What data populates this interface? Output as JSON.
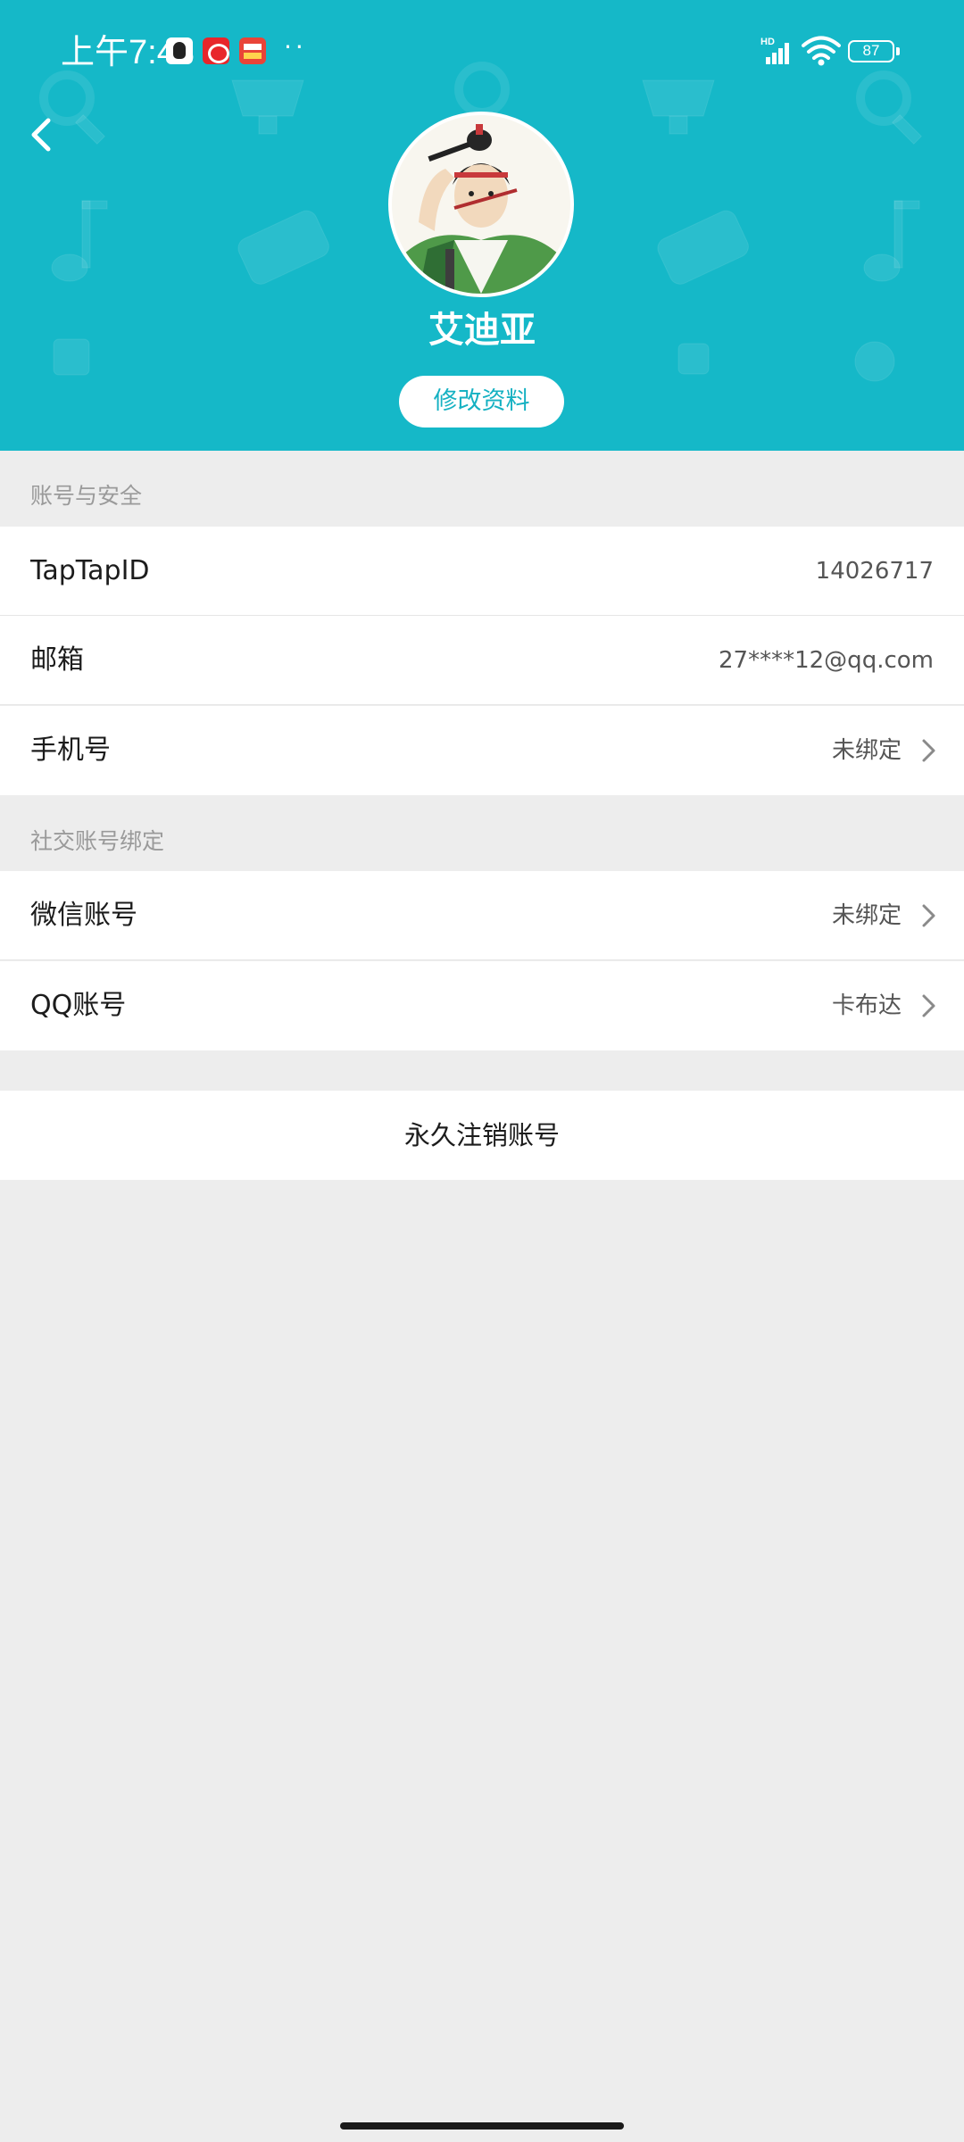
{
  "status_bar": {
    "time": "上午7:48",
    "dots": "··",
    "battery": "87",
    "network_label": "HD"
  },
  "header": {
    "username": "艾迪亚",
    "edit_button_label": "修改资料"
  },
  "sections": {
    "account_security": {
      "label": "账号与安全",
      "rows": [
        {
          "label": "TapTapID",
          "value": "14026717"
        },
        {
          "label": "邮箱",
          "value": "27****12@qq.com"
        },
        {
          "label": "手机号",
          "value": "未绑定"
        }
      ]
    },
    "social_binding": {
      "label": "社交账号绑定",
      "rows": [
        {
          "label": "微信账号",
          "value": "未绑定"
        },
        {
          "label": "QQ账号",
          "value": "卡布达"
        }
      ]
    }
  },
  "delete_account_label": "永久注销账号",
  "colors": {
    "header_background": "#15b8c8",
    "accent": "#15b1c2",
    "page_background": "#ededed"
  }
}
